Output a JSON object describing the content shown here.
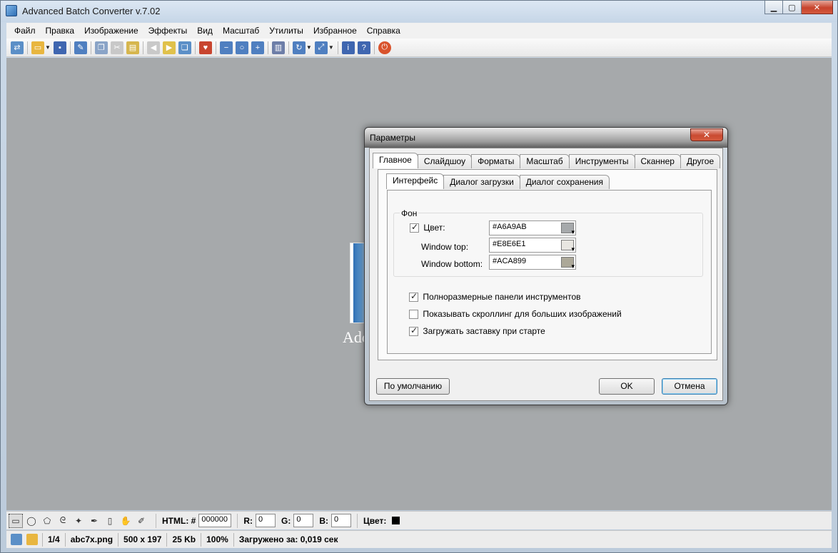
{
  "window": {
    "title": "Advanced Batch Converter v.7.02",
    "minimize": "▁",
    "maximize": "▢",
    "close": "✕"
  },
  "menu": [
    "Файл",
    "Правка",
    "Изображение",
    "Эффекты",
    "Вид",
    "Масштаб",
    "Утилиты",
    "Избранное",
    "Справка"
  ],
  "preview": {
    "text": "Ado"
  },
  "dialog": {
    "title": "Параметры",
    "close": "✕",
    "tabs": [
      "Главное",
      "Слайдшоу",
      "Форматы",
      "Масштаб",
      "Инструменты",
      "Сканнер",
      "Другое"
    ],
    "subtabs": [
      "Интерфейс",
      "Диалог загрузки",
      "Диалог сохранения"
    ],
    "group_label": "Фон",
    "color_checkbox_label": "Цвет:",
    "color_value": "#A6A9AB",
    "window_top_label": "Window top:",
    "window_top_value": "#E8E6E1",
    "window_bottom_label": "Window bottom:",
    "window_bottom_value": "#ACA899",
    "option_fullsize_toolbars": "Полноразмерные панели инструментов",
    "option_show_scrolling": "Показывать скроллинг для больших изображений",
    "option_splash": "Загружать заставку при старте",
    "btn_default": "По умолчанию",
    "btn_ok": "OK",
    "btn_cancel": "Отмена",
    "swatch_colors": {
      "color": "#A6A9AB",
      "top": "#E8E6E1",
      "bottom": "#ACA899"
    }
  },
  "toolpanel": {
    "html_label": "HTML: #",
    "html_value": "000000",
    "r_label": "R:",
    "r_value": "0",
    "g_label": "G:",
    "g_value": "0",
    "b_label": "B:",
    "b_value": "0",
    "color_label": "Цвет:"
  },
  "status": {
    "page": "1/4",
    "filename": "abc7x.png",
    "dimensions": "500 x 197",
    "size": "25 Kb",
    "zoom": "100%",
    "loaded": "Загружено за: 0,019 сек"
  }
}
